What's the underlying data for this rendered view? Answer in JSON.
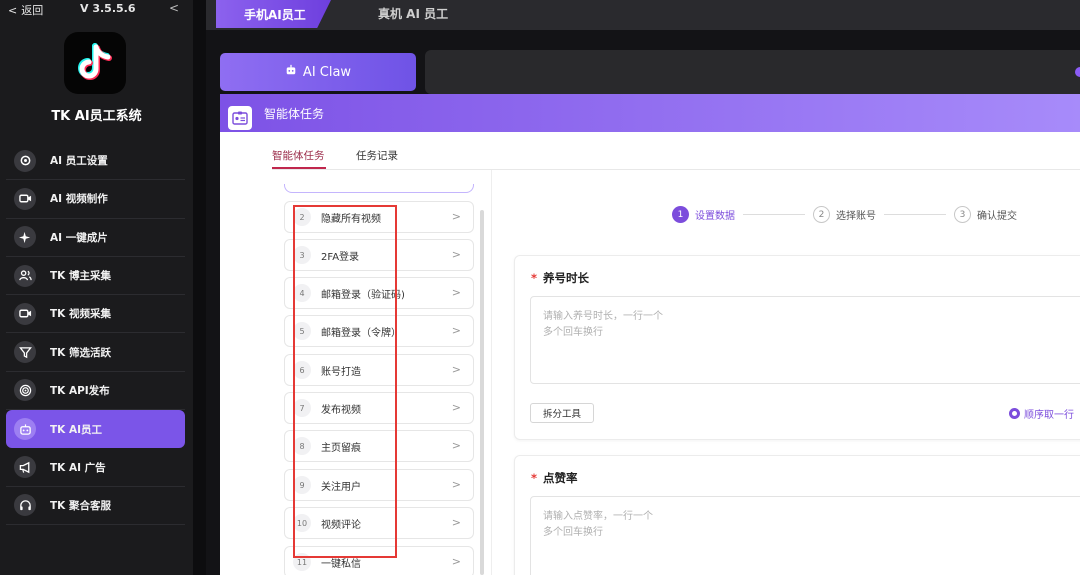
{
  "sidebar": {
    "back_label": "返回",
    "version": "V 3.5.5.6",
    "app_title": "TK AI员工系统",
    "items": [
      {
        "label": "AI 员工设置",
        "icon": "gear-icon"
      },
      {
        "label": "AI 视频制作",
        "icon": "video-camera-icon"
      },
      {
        "label": "AI 一键成片",
        "icon": "sparkle-icon"
      },
      {
        "label": "TK 博主采集",
        "icon": "users-icon"
      },
      {
        "label": "TK 视频采集",
        "icon": "video-camera-icon"
      },
      {
        "label": "TK 筛选活跃",
        "icon": "filter-icon"
      },
      {
        "label": "TK API发布",
        "icon": "target-icon"
      },
      {
        "label": "TK AI员工",
        "icon": "robot-icon",
        "active": true
      },
      {
        "label": "TK AI 广告",
        "icon": "megaphone-icon"
      },
      {
        "label": "TK 聚合客服",
        "icon": "headset-icon"
      }
    ]
  },
  "tabs": {
    "mobile": "手机AI员工",
    "real": "真机 AI 员工"
  },
  "ai_claw_label": "AI Claw",
  "panel": {
    "title": "智能体任务",
    "subtabs": [
      "智能体任务",
      "任务记录"
    ],
    "task_list": [
      {
        "num": "2",
        "label": "隐藏所有视频"
      },
      {
        "num": "3",
        "label": "2FA登录"
      },
      {
        "num": "4",
        "label": "邮箱登录（验证码)"
      },
      {
        "num": "5",
        "label": "邮箱登录（令牌）"
      },
      {
        "num": "6",
        "label": "账号打造"
      },
      {
        "num": "7",
        "label": "发布视频"
      },
      {
        "num": "8",
        "label": "主页留痕"
      },
      {
        "num": "9",
        "label": "关注用户"
      },
      {
        "num": "10",
        "label": "视频评论"
      },
      {
        "num": "11",
        "label": "一键私信"
      }
    ],
    "steps": [
      {
        "num": "1",
        "label": "设置数据",
        "active": true
      },
      {
        "num": "2",
        "label": "选择账号",
        "active": false
      },
      {
        "num": "3",
        "label": "确认提交",
        "active": false
      }
    ],
    "field1": {
      "title": "养号时长",
      "placeholder": "请输入养号时长，一行一个\n多个回车换行",
      "split_button": "拆分工具",
      "order_option": "顺序取一行"
    },
    "field2": {
      "title": "点赞率",
      "placeholder": "请输入点赞率，一行一个\n多个回车换行"
    }
  },
  "colors": {
    "accent": "#7c4ddc",
    "sidebar_bg": "#1b1b1d",
    "highlight_box": "#e53935"
  }
}
